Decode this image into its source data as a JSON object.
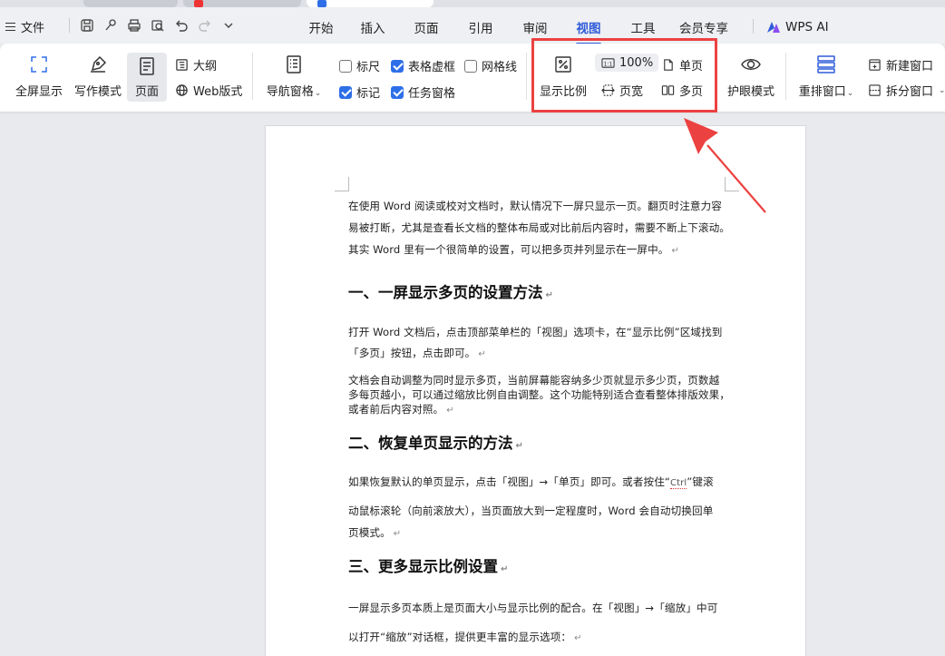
{
  "menu": {
    "file_label": "文件",
    "tabs": [
      {
        "label": "开始",
        "active": false
      },
      {
        "label": "插入",
        "active": false
      },
      {
        "label": "页面",
        "active": false
      },
      {
        "label": "引用",
        "active": false
      },
      {
        "label": "审阅",
        "active": false
      },
      {
        "label": "视图",
        "active": true
      },
      {
        "label": "工具",
        "active": false
      },
      {
        "label": "会员专享",
        "active": false
      }
    ],
    "wps_ai_label": "WPS AI"
  },
  "ribbon": {
    "fullscreen": "全屏显示",
    "writing_mode": "写作模式",
    "page": "页面",
    "outline": "大纲",
    "web_layout": "Web版式",
    "nav_pane": "导航窗格",
    "ruler": "标尺",
    "table_gridlines": "表格虚框",
    "gridlines": "网格线",
    "marks": "标记",
    "task_pane": "任务窗格",
    "zoom": "显示比例",
    "zoom_100": "100%",
    "page_width": "页宽",
    "single_page": "单页",
    "multi_page": "多页",
    "eye_protection": "护眼模式",
    "rearrange_windows": "重排窗口",
    "new_window": "新建窗口",
    "split_window": "拆分窗口",
    "checks": {
      "ruler": false,
      "table_gridlines": true,
      "gridlines": false,
      "marks": true,
      "task_pane": true
    }
  },
  "document": {
    "p1_l1": "在使用 Word 阅读或校对文档时，默认情况下一屏只显示一页。翻页时注意力容",
    "p1_l2": "易被打断，尤其是查看长文档的整体布局或对比前后内容时，需要不断上下滚动。",
    "p1_l3": "其实 Word 里有一个很简单的设置，可以把多页并列显示在一屏中。",
    "h1": "一、一屏显示多页的设置方法",
    "p2_l1": "打开 Word 文档后，点击顶部菜单栏的「视图」选项卡，在“显示比例”区域找到",
    "p2_l2": "「多页」按钮，点击即可。",
    "p3_l1": "文档会自动调整为同时显示多页，当前屏幕能容纳多少页就显示多少页，页数越",
    "p3_l2": "多每页越小，可以通过缩放比例自由调整。这个功能特别适合查看整体排版效果，",
    "p3_l3": "或者前后内容对照。",
    "h2": "二、恢复单页显示的方法",
    "p4_l1a": "如果恢复默认的单页显示，点击「视图」→「单页」即可。或者按住“",
    "p4_ctrl": "Ctrl",
    "p4_l1b": "”键滚",
    "p4_l2": "动鼠标滚轮（向前滚放大），当页面放大到一定程度时，Word 会自动切换回单",
    "p4_l3": "页模式。",
    "h3": "三、更多显示比例设置",
    "p5_l1": "一屏显示多页本质上是页面大小与显示比例的配合。在「视图」→「缩放」中可",
    "p5_l2": "以打开“缩放”对话框，提供更丰富的显示选项：",
    "para_mark": "↵"
  },
  "colors": {
    "accent": "#2e5bd8",
    "highlight": "#ec4141",
    "checkbox": "#2e6fe8"
  }
}
